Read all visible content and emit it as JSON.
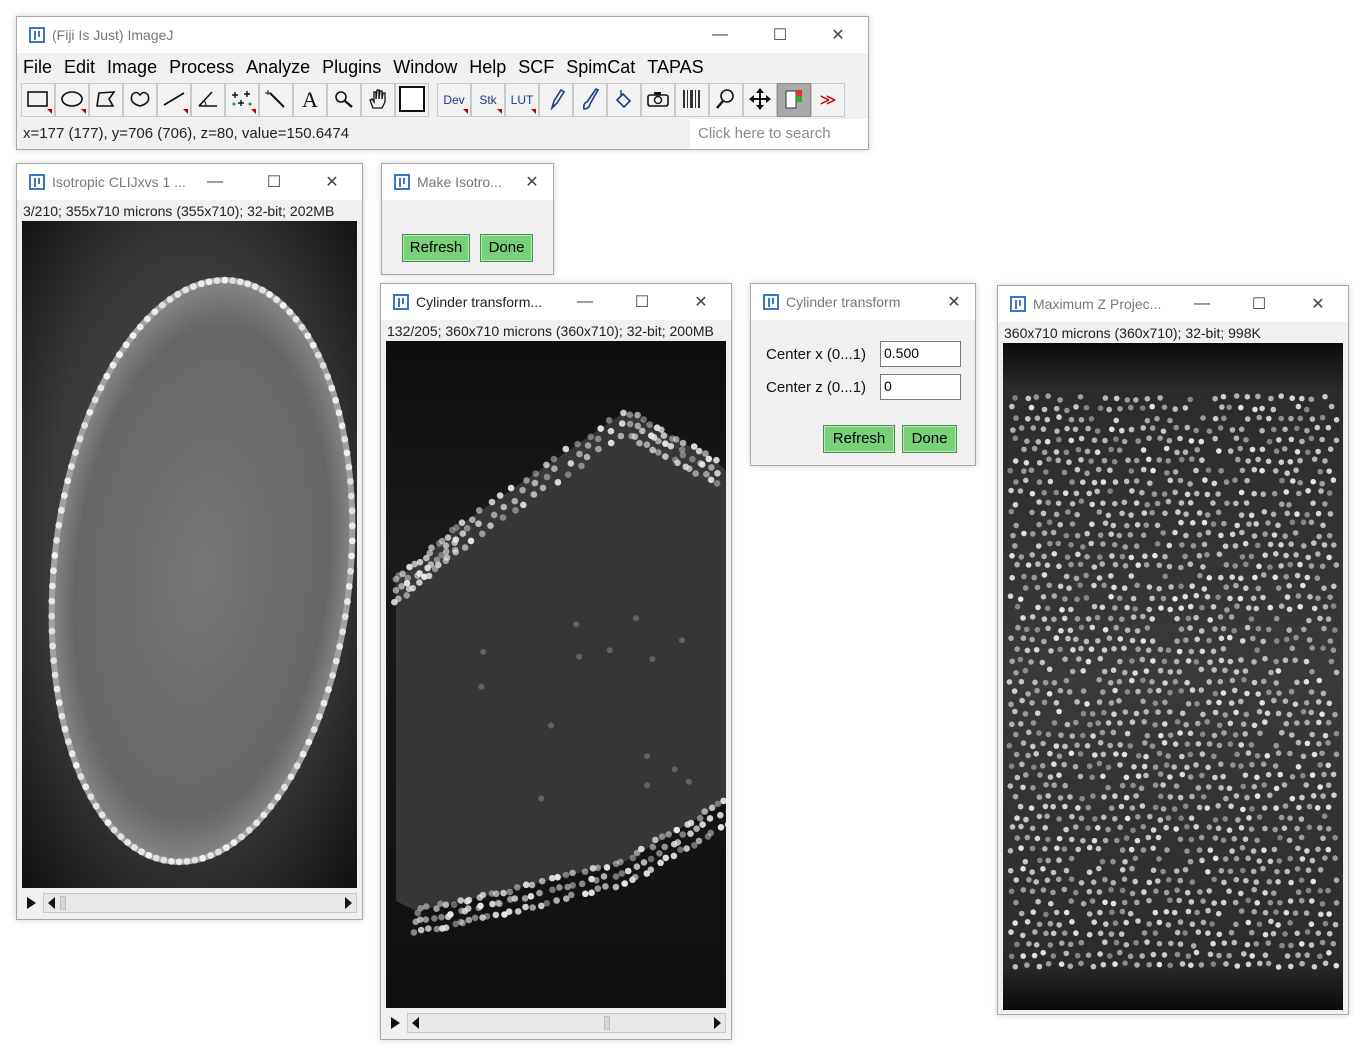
{
  "main_window": {
    "title": "(Fiji Is Just) ImageJ",
    "menu": [
      "File",
      "Edit",
      "Image",
      "Process",
      "Analyze",
      "Plugins",
      "Window",
      "Help",
      "SCF",
      "SpimCat",
      "TAPAS"
    ],
    "toolbar": {
      "tools": [
        "rectangle-icon",
        "oval-icon",
        "polygon-icon",
        "freehand-icon",
        "line-icon",
        "angle-icon",
        "multipoint-icon",
        "wand-icon",
        "text-icon",
        "magnifier-icon",
        "hand-icon",
        "color-picker-icon"
      ],
      "dev_label": "Dev",
      "stk_label": "Stk",
      "lut_label": "LUT",
      "extra_tools": [
        "pencil-icon",
        "brush-icon",
        "flood-fill-icon",
        "camera-icon",
        "barcode-icon",
        "magnifying-glass-icon",
        "move-arrows-icon",
        "color-swatch-icon"
      ],
      "more_label": "≫"
    },
    "status": "x=177 (177), y=706 (706), z=80, value=150.6474",
    "search_placeholder": "Click here to search"
  },
  "isotropic_window": {
    "title": "Isotropic CLIJxvs 1 ...",
    "info": "3/210; 355x710 microns (355x710); 32-bit; 202MB"
  },
  "make_isotropic_dialog": {
    "title": "Make Isotro...",
    "refresh_label": "Refresh",
    "done_label": "Done"
  },
  "cylinder_image_window": {
    "title": "Cylinder transform...",
    "info": "132/205; 360x710 microns (360x710); 32-bit; 200MB"
  },
  "cylinder_dialog": {
    "title": "Cylinder transform",
    "center_x_label": "Center x (0...1)",
    "center_x_value": "0.500",
    "center_z_label": "Center z (0...1)",
    "center_z_value": "0",
    "refresh_label": "Refresh",
    "done_label": "Done"
  },
  "max_projection_window": {
    "title": "Maximum Z Projec...",
    "info": "360x710 microns (360x710); 32-bit; 998K"
  },
  "window_controls": {
    "minimize": "—",
    "maximize": "☐",
    "close": "✕"
  },
  "colors": {
    "button_green": "#78d078",
    "canvas_black": "#000000",
    "title_text": "#777777",
    "logo_blue": "#3b77c7"
  }
}
